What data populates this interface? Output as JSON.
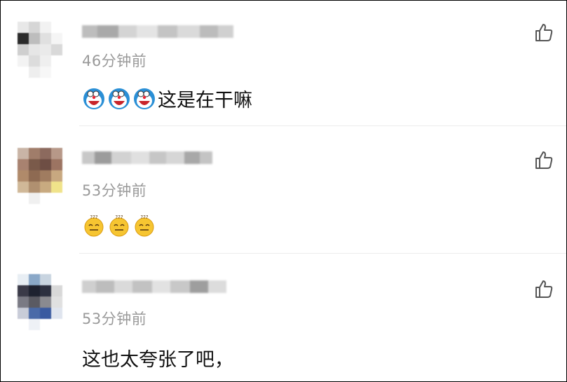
{
  "comments": [
    {
      "time": "46分钟前",
      "emoji": [
        "doraemon-laugh-emoji",
        "doraemon-laugh-emoji",
        "doraemon-laugh-emoji"
      ],
      "text": "这是在干嘛"
    },
    {
      "time": "53分钟前",
      "emoji": [
        "dizzy-face-emoji",
        "dizzy-face-emoji",
        "dizzy-face-emoji"
      ],
      "text": ""
    },
    {
      "time": "53分钟前",
      "emoji": [],
      "text": "这也太夸张了吧，"
    }
  ],
  "icons": {
    "like": "thumbs-up-icon"
  },
  "colors": {
    "time_text": "#9a9a9a",
    "body_text": "#111111",
    "divider": "#ececec"
  }
}
